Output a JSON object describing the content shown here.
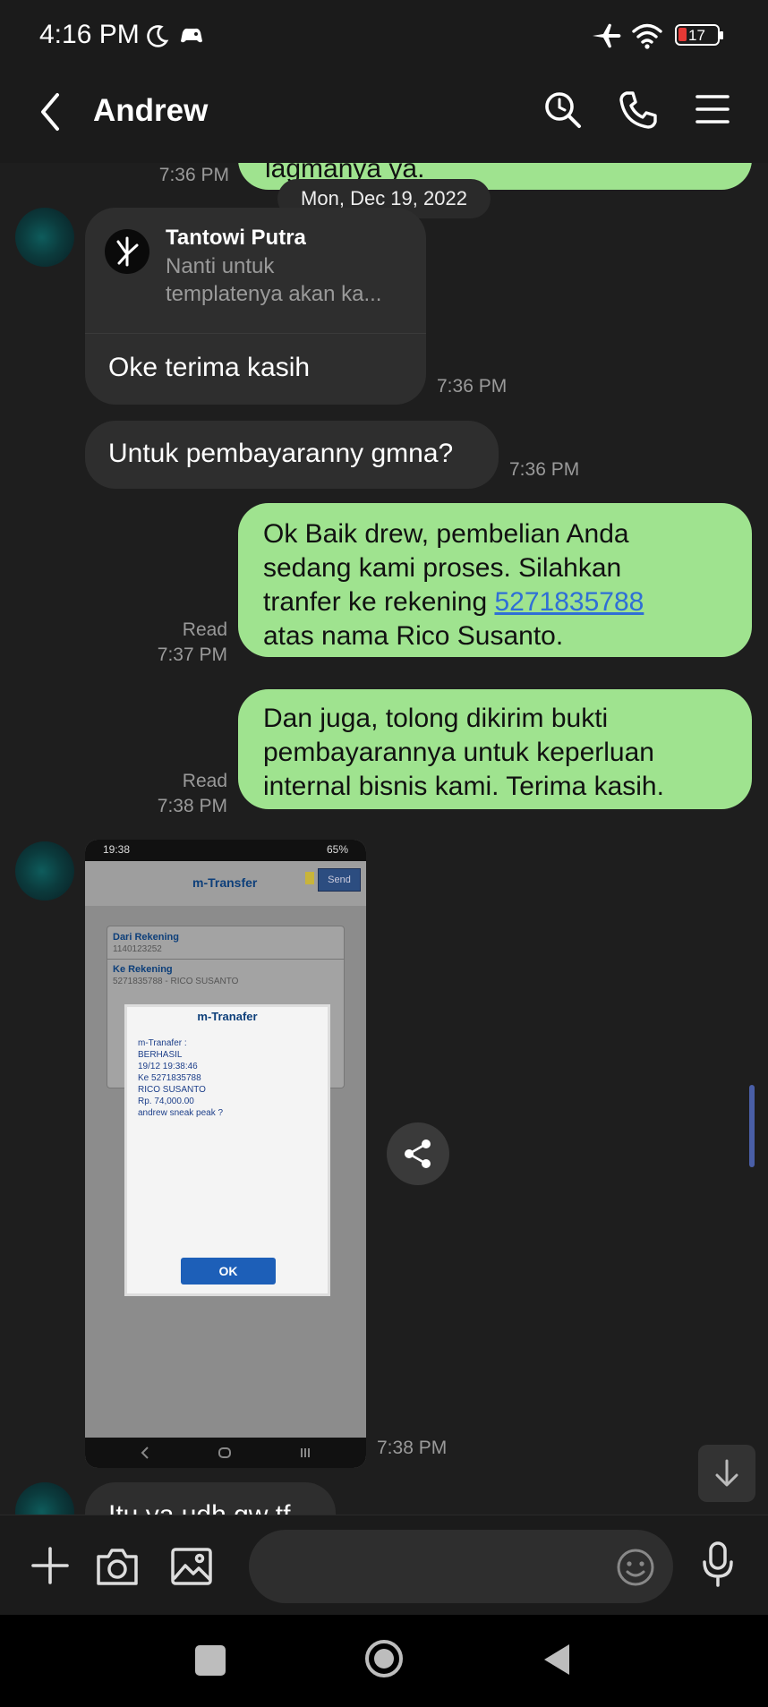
{
  "status_bar": {
    "time": "4:16 PM",
    "battery": "17"
  },
  "header": {
    "contact_name": "Andrew"
  },
  "chat": {
    "date_divider": "Mon, Dec 19, 2022",
    "prev_out_partial": {
      "text": "lagmanya ya.",
      "time": "7:36 PM"
    },
    "msg_reply": {
      "quoted_author": "Tantowi Putra",
      "quoted_text_line1": "Nanti untuk",
      "quoted_text_line2": "templatenya akan ka...",
      "text": "Oke terima kasih",
      "time": "7:36 PM"
    },
    "msg_payment_q": {
      "text": "Untuk pembayaranny gmna?",
      "time": "7:36 PM"
    },
    "msg_out_1": {
      "line1": "Ok Baik drew, pembelian Anda",
      "line2": "sedang kami proses. Silahkan",
      "line3_prefix": "tranfer ke rekening ",
      "account_link": "5271835788",
      "line4": "atas nama Rico Susanto.",
      "read": "Read",
      "time": "7:37 PM"
    },
    "msg_out_2": {
      "line1": "Dan juga, tolong dikirim bukti",
      "line2": "pembayarannya untuk keperluan",
      "line3": "internal bisnis kami. Terima kasih.",
      "read": "Read",
      "time": "7:38 PM"
    },
    "image_msg": {
      "time": "7:38 PM",
      "shot_status_time": "19:38",
      "shot_battery": "65%",
      "shot_title": "m-Transfer",
      "shot_button": "Send",
      "shot_field1_label": "Dari Rekening",
      "shot_field1_value": "1140123252",
      "shot_field2_label": "Ke Rekening",
      "shot_field2_value": "5271835788 - RICO SUSANTO",
      "dialog_title": "m-Tranafer",
      "dialog_lines": [
        "m-Tranafer :",
        "BERHASIL",
        "19/12 19:38:46",
        "Ke 5271835788",
        "RICO SUSANTO",
        "Rp. 74,000.00",
        "andrew sneak peak ?"
      ],
      "dialog_ok": "OK"
    },
    "last_partial": {
      "text": "Itu ya udh gw tf"
    }
  },
  "colors": {
    "outgoing_bubble": "#9fe38f",
    "incoming_bubble": "#2e2e2e",
    "background": "#1e1e1e",
    "link": "#2f6fd6"
  },
  "icons": [
    "back-arrow-icon",
    "search-icon",
    "phone-icon",
    "menu-icon",
    "plus-icon",
    "camera-icon",
    "gallery-icon",
    "emoji-icon",
    "mic-icon",
    "share-icon",
    "scroll-down-icon"
  ]
}
